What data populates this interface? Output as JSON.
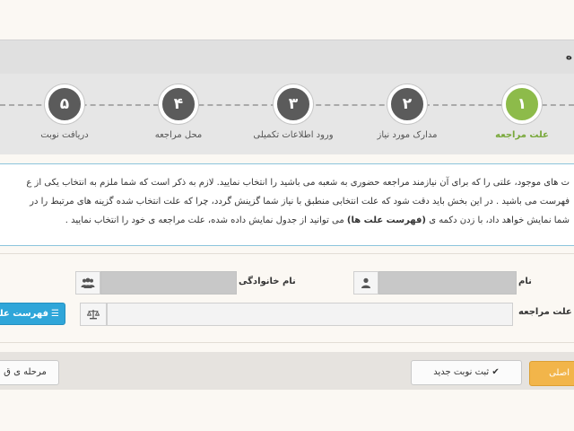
{
  "header": {
    "title": "ه"
  },
  "steps": [
    {
      "number": "۱",
      "label": "علت مراجعه",
      "active": true
    },
    {
      "number": "۲",
      "label": "مدارک مورد نیاز",
      "active": false
    },
    {
      "number": "۳",
      "label": "ورود اطلاعات تکمیلی",
      "active": false
    },
    {
      "number": "۴",
      "label": "محل مراجعه",
      "active": false
    },
    {
      "number": "۵",
      "label": "دریافت نوبت",
      "active": false
    }
  ],
  "info": {
    "line1": "ت های موجود، علتی را که برای آن نیازمند مراجعه حضوری به شعبه می باشید را انتخاب نمایید. لازم به ذکر است که شما ملزم به انتخاب یکی از ع",
    "line2": "فهرست می باشید . در این بخش باید دقت شود که علت انتخابی منطبق با نیاز شما گزینش گردد، چرا که علت انتخاب شده گزینه های مرتبط را در",
    "line3_pre": "شما نمایش خواهد داد، با زدن دکمه ی ",
    "line3_bold": "(فهرست علت ها)",
    "line3_post": " می توانید از جدول نمایش داده شده، علت مراجعه ی خود را انتخاب نمایید ."
  },
  "form": {
    "name_label": "نام",
    "family_label": "نام خانوادگی",
    "reason_label": "علت مراجعه",
    "required_mark": "*",
    "list_button": "فهرست علت ها"
  },
  "footer": {
    "prev_button": "مرحله ی ق",
    "new_appointment_button": "ثبت نوبت جدید",
    "main_button": "اصلی"
  }
}
